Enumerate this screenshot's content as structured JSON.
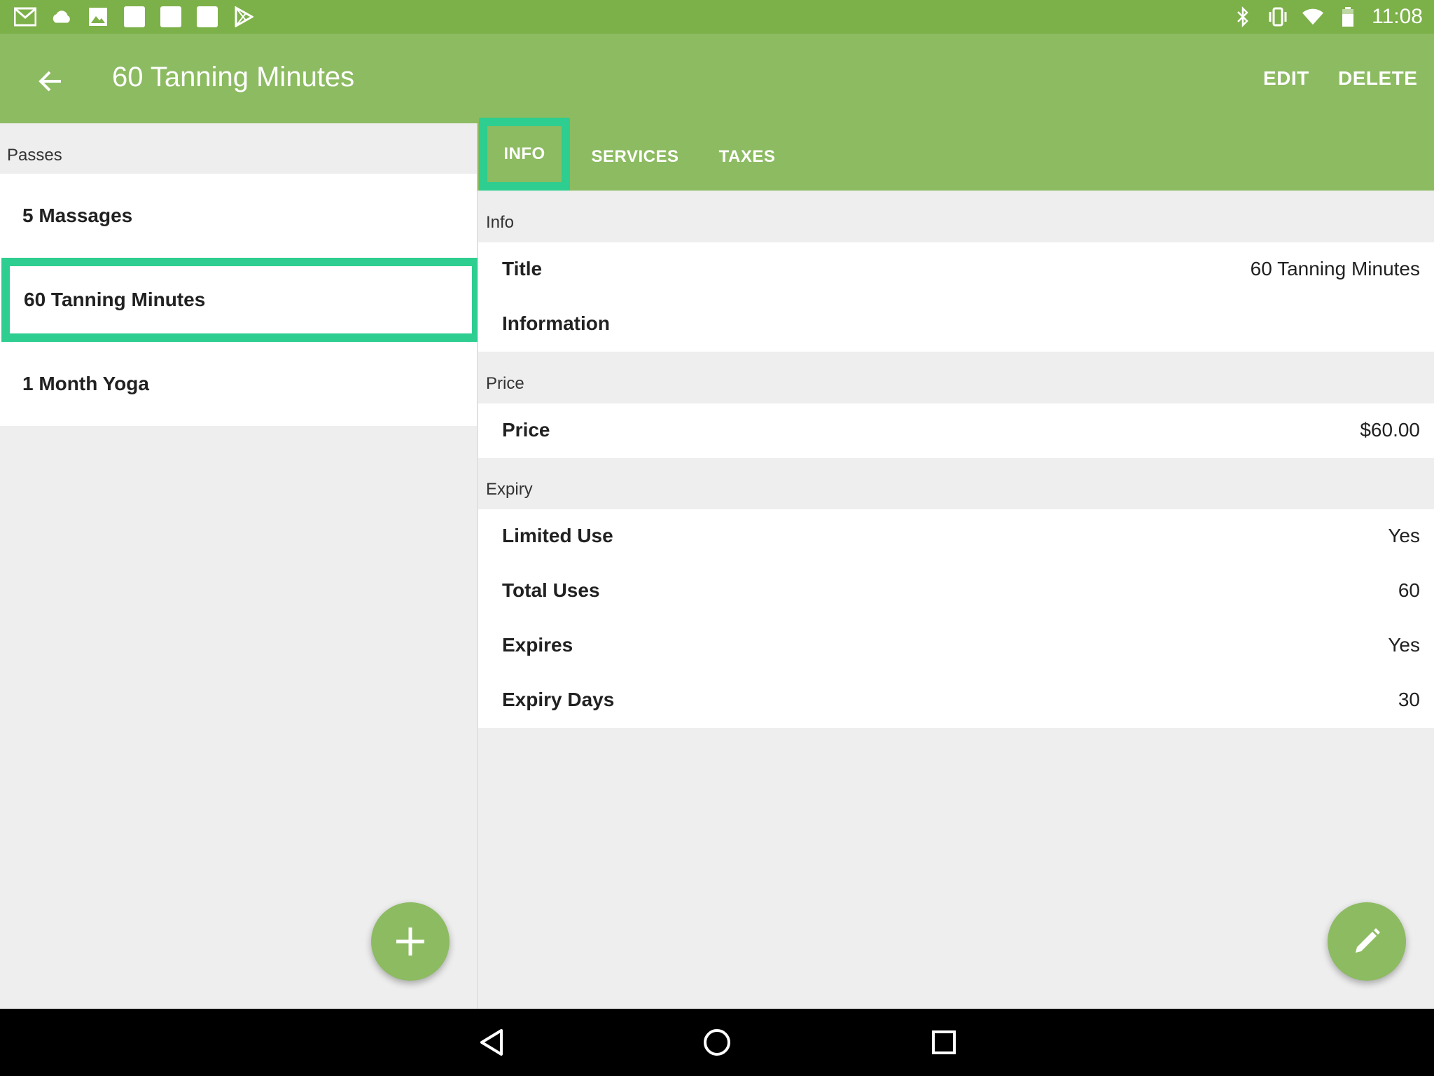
{
  "status_bar": {
    "left_icons": [
      "gmail-icon",
      "cloud-icon",
      "image-icon",
      "notification-icon",
      "notification-icon",
      "notification-icon",
      "play-store-icon"
    ],
    "right_icons": [
      "bluetooth-icon",
      "vibrate-icon",
      "wifi-icon",
      "battery-icon"
    ],
    "time": "11:08"
  },
  "app_bar": {
    "title": "60 Tanning Minutes",
    "edit_label": "EDIT",
    "delete_label": "DELETE"
  },
  "left_pane": {
    "header": "Passes",
    "items": [
      {
        "label": "5 Massages",
        "selected": false
      },
      {
        "label": "60 Tanning Minutes",
        "selected": true
      },
      {
        "label": "1 Month Yoga",
        "selected": false
      }
    ]
  },
  "tabs": [
    {
      "label": "INFO",
      "active": true
    },
    {
      "label": "SERVICES",
      "active": false
    },
    {
      "label": "TAXES",
      "active": false
    }
  ],
  "detail": {
    "info": {
      "header": "Info",
      "rows": [
        {
          "label": "Title",
          "value": "60 Tanning Minutes"
        },
        {
          "label": "Information",
          "value": ""
        }
      ]
    },
    "price": {
      "header": "Price",
      "rows": [
        {
          "label": "Price",
          "value": "$60.00"
        }
      ]
    },
    "expiry": {
      "header": "Expiry",
      "rows": [
        {
          "label": "Limited Use",
          "value": "Yes"
        },
        {
          "label": "Total Uses",
          "value": "60"
        },
        {
          "label": "Expires",
          "value": "Yes"
        },
        {
          "label": "Expiry Days",
          "value": "30"
        }
      ]
    }
  },
  "colors": {
    "status_bar": "#7cb048",
    "app_bar": "#8dbb62",
    "highlight": "#2dce8f",
    "background": "#eeeeee"
  }
}
